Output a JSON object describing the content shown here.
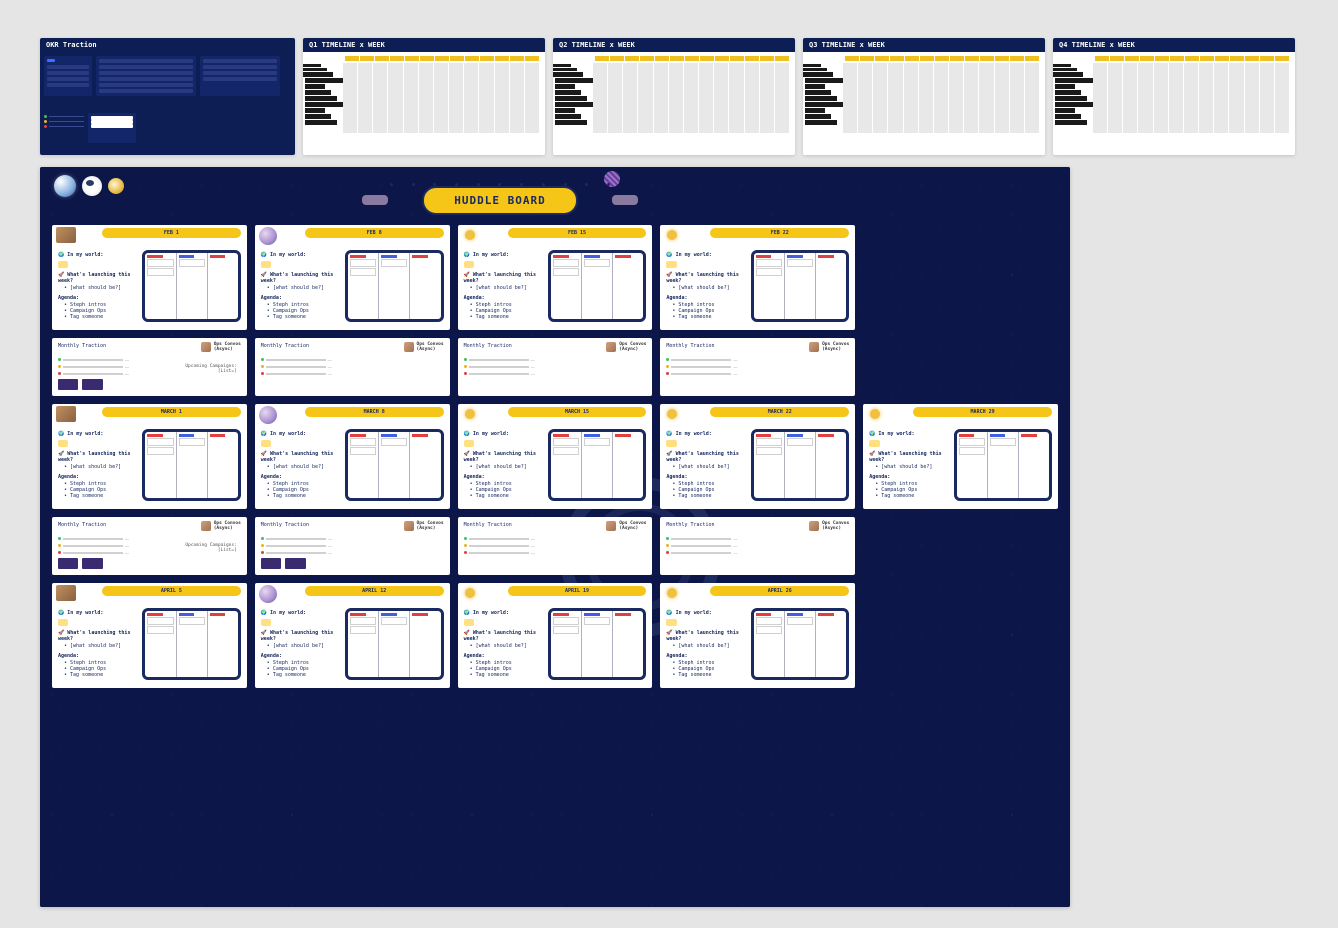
{
  "frames": {
    "okr_title": "OKR Traction",
    "timeline_titles": [
      "Q1 TIMELINE x WEEK",
      "Q2 TIMELINE x WEEK",
      "Q3 TIMELINE x WEEK",
      "Q4 TIMELINE x WEEK"
    ]
  },
  "huddle_banner": "HUDDLE BOARD",
  "huddle_card_template": {
    "in_my_world": "In my world:",
    "launching": "What's launching this week?",
    "launching_sub": "[what should be?]",
    "agenda_label": "Agenda:",
    "agenda_items": [
      "Steph intros",
      "Campaign Ops",
      "Tag someone"
    ]
  },
  "traction_template": {
    "title": "Monthly Traction",
    "convo_name": "Ops Convos",
    "convo_sub": "(Async)",
    "upcoming_label": "Upcoming Campaigns:",
    "upcoming_sub": "[List=]"
  },
  "weeks": [
    {
      "date": "FEB 1",
      "corner": "ava",
      "traction": "full"
    },
    {
      "date": "FEB 8",
      "corner": "planet",
      "traction": "bars"
    },
    {
      "date": "FEB 15",
      "corner": "sun",
      "traction": "bars"
    },
    {
      "date": "FEB 22",
      "corner": "sun",
      "traction": "bars"
    },
    {
      "date": "",
      "corner": "none",
      "skip": true
    },
    {
      "date": "MARCH 1",
      "corner": "ava",
      "traction": "full"
    },
    {
      "date": "MARCH 8",
      "corner": "planet",
      "traction": "btns"
    },
    {
      "date": "MARCH 15",
      "corner": "sun",
      "traction": "bars"
    },
    {
      "date": "MARCH 22",
      "corner": "sun",
      "traction": "bars"
    },
    {
      "date": "MARCH 29",
      "corner": "sun",
      "traction": "none"
    },
    {
      "date": "APRIL 5",
      "corner": "ava",
      "traction": "none"
    },
    {
      "date": "APRIL 12",
      "corner": "planet",
      "traction": "none"
    },
    {
      "date": "APRIL 19",
      "corner": "sun",
      "traction": "none"
    },
    {
      "date": "APRIL 26",
      "corner": "sun",
      "traction": "none"
    },
    {
      "date": "",
      "corner": "none",
      "skip": true
    }
  ],
  "legend_colors": [
    "#40c060",
    "#f0b020",
    "#e04040",
    "#4060e0"
  ]
}
